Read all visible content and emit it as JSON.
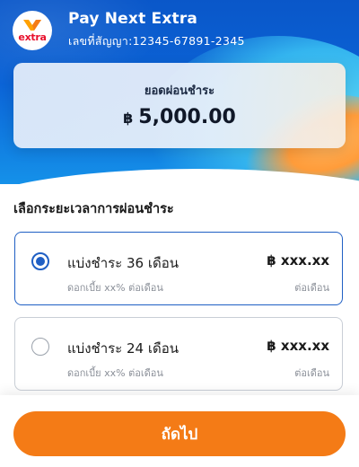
{
  "header": {
    "logo_text": "extra",
    "app_title": "Pay Next Extra",
    "contract_label": "เลขที่สัญญา:",
    "contract_number": "12345-67891-2345"
  },
  "summary": {
    "label": "ยอดผ่อนชำระ",
    "currency": "฿",
    "amount": "5,000.00"
  },
  "section": {
    "title": "เลือกระยะเวลาการผ่อนชำระ"
  },
  "options": [
    {
      "title": "แบ่งชำระ 36 เดือน",
      "subtitle": "ดอกเบี้ย xx% ต่อเดือน",
      "price": "฿ xxx.xx",
      "price_unit": "ต่อเดือน",
      "selected": true
    },
    {
      "title": "แบ่งชำระ 24 เดือน",
      "subtitle": "ดอกเบี้ย xx% ต่อเดือน",
      "price": "฿ xxx.xx",
      "price_unit": "ต่อเดือน",
      "selected": false
    }
  ],
  "footer": {
    "next_label": "ถัดไป"
  },
  "colors": {
    "primary_blue": "#0b63d6",
    "accent_orange": "#f47b16",
    "brand_red": "#e8112d",
    "selected_border": "#1f5fc4"
  },
  "icons": {
    "logo": "extra-logo-icon",
    "radio_on": "radio-selected-icon",
    "radio_off": "radio-unselected-icon"
  }
}
